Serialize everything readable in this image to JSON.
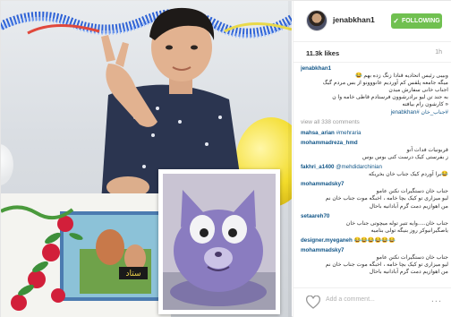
{
  "post": {
    "username": "jenabkhan1",
    "follow_label": "FOLLOWING",
    "likes": "11.3k likes",
    "time": "1h",
    "view_all": "view all 338 comments",
    "comment_placeholder": "Add a comment...",
    "more": "..."
  },
  "comments": [
    {
      "user": "jenabkhan1",
      "lines": [
        "وبیبی رئیس اتحادیه قنادا زنگ زده بهم 😂",
        "میگه جامعه پلقس کم آوردیم عانووونو از بس مردم گیگ",
        "اجناب خانی سفارش میدن",
        "به جند تن لیو برادرشوون فرستادم قاطی خامه وا ن",
        "« کارشون رام بیافته",
        "#جناب_خان #jenabkhan"
      ]
    },
    {
      "user": "mahsa_arian",
      "lines": [
        "#mehraria"
      ]
    },
    {
      "user": "mohammadreza_hmd",
      "lines": [
        "قربونیات فدات آنو",
        "ز بفرستی کیک درست کنی بوس بوس"
      ]
    },
    {
      "user": "fakhri_a1400",
      "lines": [
        "@mehdidarchinian",
        "😂برا آوردم کیک جناب خان بخریکه"
      ]
    },
    {
      "user": "mohammadsky7",
      "lines": [
        "جناب خان دستگیرات نکنن عامو",
        "لیو میزاری تو کیک بچا خامه ، اخبگه موت جناب خان نم",
        "من اهوازیم دمت گرم آبادانیه باحال"
      ]
    },
    {
      "user": "setaareh70",
      "lines": [
        "جناب خان.....وایه تتیر توله میچوتی جناب خان",
        "یاصگیرانیوکر روز بنیگه تولی بنامیه"
      ]
    },
    {
      "user": "designer.myeganeh",
      "lines": [
        "😂😂😂😂😂😂"
      ]
    },
    {
      "user": "mohammadsky7",
      "lines": [
        "جناب خان دستگیرات نکنن عامو",
        "لیو میزاری تو کیک بچا خامه ، اخبگه موت جناب خان نم",
        "من اهوازیم دمت گرم آبادانیه باحال"
      ]
    }
  ],
  "colors": {
    "follow": "#70c050",
    "link": "#125688"
  }
}
